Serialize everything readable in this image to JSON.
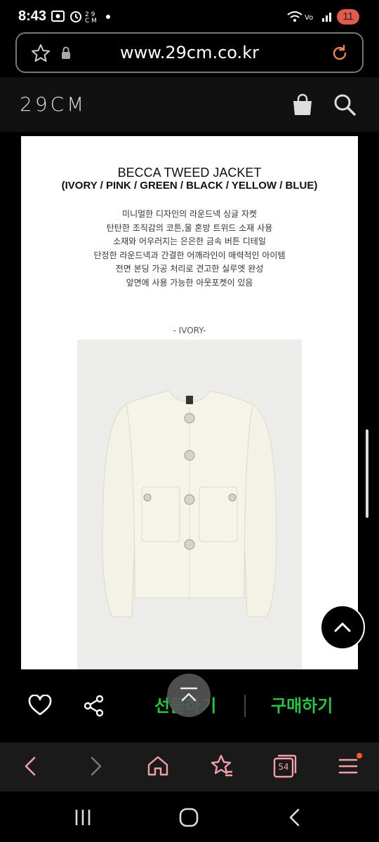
{
  "status_bar": {
    "time": "8:43",
    "battery_level": "11"
  },
  "browser": {
    "url": "www.29cm.co.kr",
    "tab_count": "54"
  },
  "site": {
    "logo": "29CM"
  },
  "product": {
    "title": "BECCA TWEED JACKET",
    "colors": "(IVORY / PINK / GREEN / BLACK / YELLOW / BLUE)",
    "description": [
      "미니멀한 디자인의 라운드넥 싱글 자켓",
      "탄탄한 조직감의 코튼,울 혼방 트위드 소재 사용",
      "소재와 어우러지는 은은한 금속 버튼 디테일",
      "단정한 라운드넥과 간결한 어깨라인이 매력적인 아이템",
      "전면 본딩 가공 처리로 견고한 실루엣 완성",
      "앞면에 사용 가능한 아웃포켓이 있음"
    ],
    "color_label": "- IVORY-"
  },
  "action_bar": {
    "gift_label": "선물하기",
    "buy_label": "구매하기"
  },
  "colors": {
    "accent_green": "#2dc14b",
    "badge_orange": "#e05a4d"
  },
  "icons": [
    "star-icon",
    "lock-icon",
    "reload-icon",
    "cart-icon",
    "search-icon",
    "heart-icon",
    "share-icon",
    "chevron-up-icon",
    "back-icon",
    "forward-icon",
    "home-icon",
    "bookmark-icon",
    "tabs-icon",
    "menu-icon"
  ]
}
